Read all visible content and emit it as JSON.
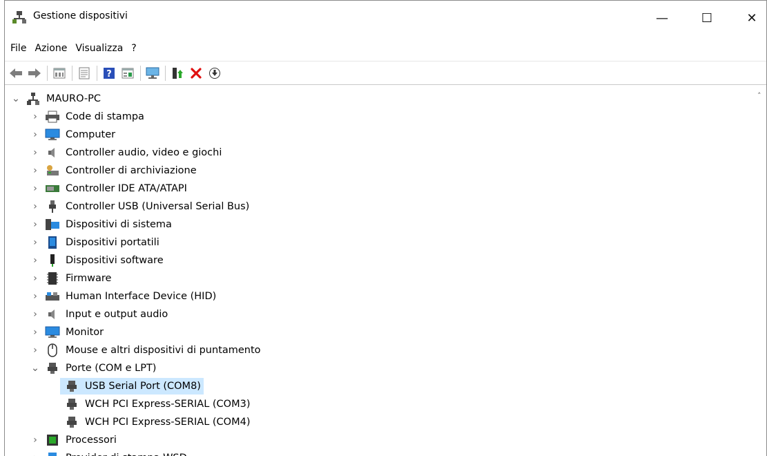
{
  "window": {
    "title": "Gestione dispositivi"
  },
  "titlebar_controls": {
    "minimize": "—",
    "maximize": "☐",
    "close": "✕"
  },
  "menu": [
    "File",
    "Azione",
    "Visualizza",
    "?"
  ],
  "toolbar_icons": [
    "back-icon",
    "forward-icon",
    "properties-view-icon",
    "details-icon",
    "help-icon",
    "view-icon",
    "scan-hardware-icon",
    "update-driver-icon",
    "uninstall-icon",
    "download-icon"
  ],
  "tree": {
    "root": "MAURO-PC",
    "categories": [
      {
        "label": "Code di stampa",
        "icon": "print-queue-icon"
      },
      {
        "label": "Computer",
        "icon": "computer-icon"
      },
      {
        "label": "Controller audio, video e giochi",
        "icon": "audio-icon"
      },
      {
        "label": "Controller di archiviazione",
        "icon": "storage-icon"
      },
      {
        "label": "Controller IDE ATA/ATAPI",
        "icon": "ide-icon"
      },
      {
        "label": "Controller USB (Universal Serial Bus)",
        "icon": "usb-icon"
      },
      {
        "label": "Dispositivi di sistema",
        "icon": "system-devices-icon"
      },
      {
        "label": "Dispositivi portatili",
        "icon": "portable-device-icon"
      },
      {
        "label": "Dispositivi software",
        "icon": "software-device-icon"
      },
      {
        "label": "Firmware",
        "icon": "firmware-icon"
      },
      {
        "label": "Human Interface Device (HID)",
        "icon": "hid-icon"
      },
      {
        "label": "Input e output audio",
        "icon": "audio-io-icon"
      },
      {
        "label": "Monitor",
        "icon": "monitor-icon"
      },
      {
        "label": "Mouse e altri dispositivi di puntamento",
        "icon": "mouse-icon"
      },
      {
        "label": "Porte (COM e LPT)",
        "icon": "port-icon"
      },
      {
        "label": "Processori",
        "icon": "processor-icon"
      },
      {
        "label": "Provider di stampa WSD",
        "icon": "wsd-print-icon"
      }
    ],
    "ports_children": [
      "USB Serial Port (COM8)",
      "WCH PCI Express-SERIAL (COM3)",
      "WCH PCI Express-SERIAL (COM4)"
    ]
  },
  "colors": {
    "selection": "#cce8ff",
    "accent": "#0078d7"
  }
}
